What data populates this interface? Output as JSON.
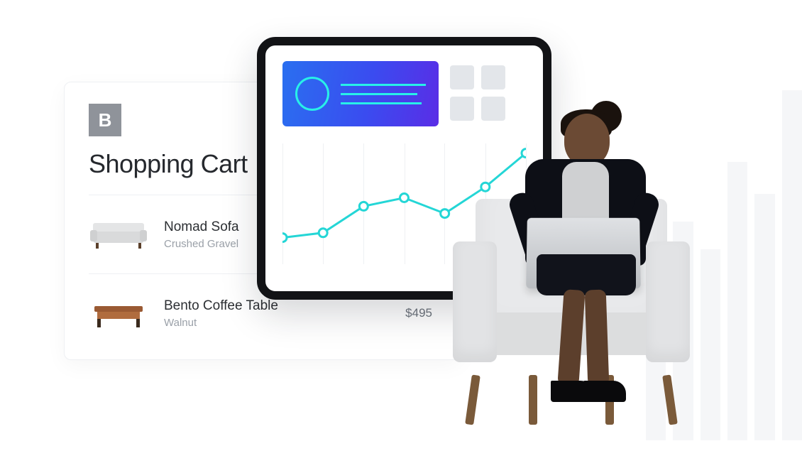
{
  "cart": {
    "logo_letter": "B",
    "title": "Shopping Cart",
    "items": [
      {
        "name": "Nomad Sofa",
        "variant": "Crushed Gravel",
        "price": ""
      },
      {
        "name": "Bento Coffee Table",
        "variant": "Walnut",
        "price": "$495"
      }
    ]
  },
  "chart_data": {
    "type": "line",
    "x": [
      1,
      2,
      3,
      4,
      5,
      6,
      7
    ],
    "values": [
      22,
      26,
      48,
      55,
      42,
      64,
      92
    ],
    "ylim": [
      0,
      100
    ],
    "color": "#24d6d6",
    "gridlines": 7
  }
}
